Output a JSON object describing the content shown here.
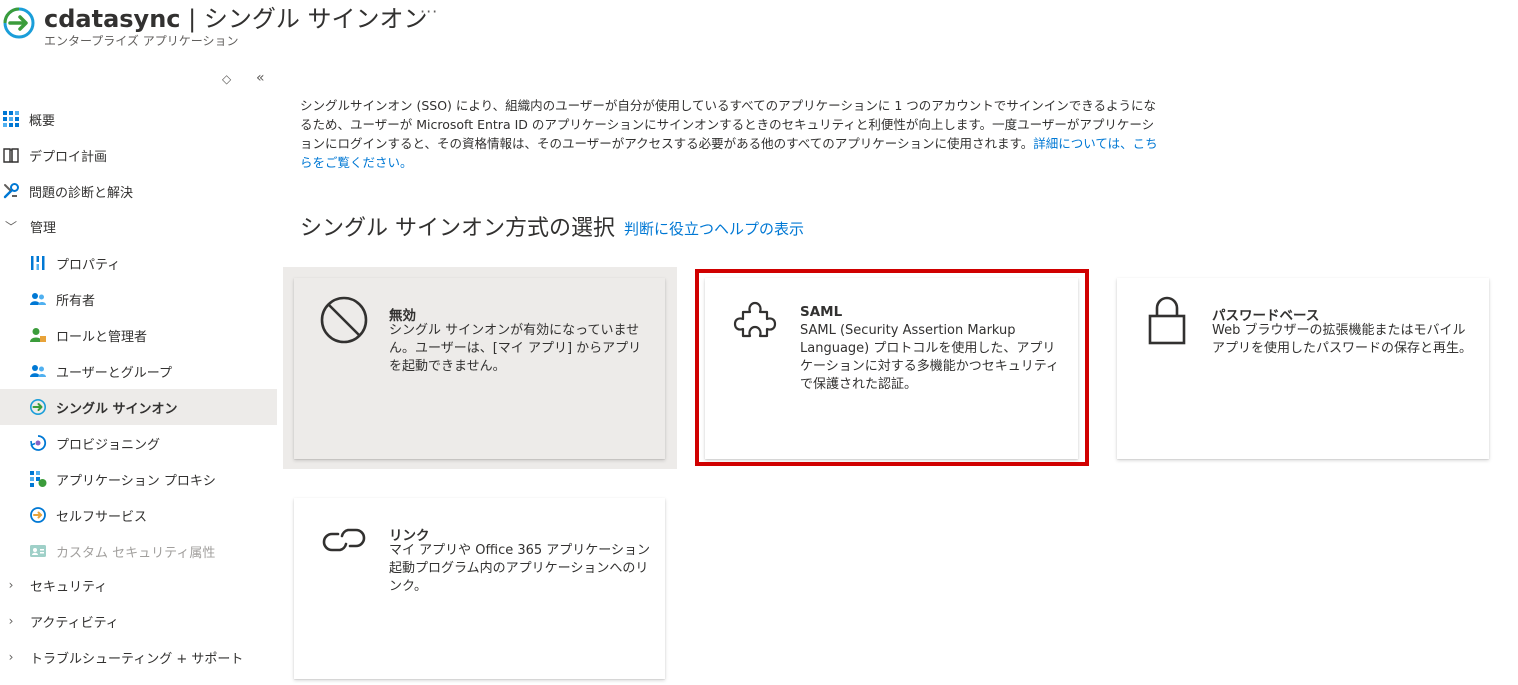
{
  "header": {
    "app_name": "cdatasync",
    "separator": "|",
    "page_name": "シングル サインオン",
    "more": "···",
    "subtitle": "エンタープライズ アプリケーション",
    "icon": "sign-in-arrow-icon"
  },
  "sidebar": {
    "tools": {
      "move": "◇",
      "collapse": "«"
    },
    "items": [
      {
        "label": "概要",
        "icon": "grid-icon"
      },
      {
        "label": "デプロイ計画",
        "icon": "book-icon"
      },
      {
        "label": "問題の診断と解決",
        "icon": "wrench-icon"
      },
      {
        "label": "管理",
        "icon": "chevron-down-icon"
      },
      {
        "label": "プロパティ",
        "icon": "properties-icon"
      },
      {
        "label": "所有者",
        "icon": "users-icon"
      },
      {
        "label": "ロールと管理者",
        "icon": "role-admin-icon"
      },
      {
        "label": "ユーザーとグループ",
        "icon": "users-groups-icon"
      },
      {
        "label": "シングル サインオン",
        "icon": "sign-in-arrow-icon"
      },
      {
        "label": "プロビジョニング",
        "icon": "provisioning-icon"
      },
      {
        "label": "アプリケーション プロキシ",
        "icon": "proxy-icon"
      },
      {
        "label": "セルフサービス",
        "icon": "self-service-icon"
      },
      {
        "label": "カスタム セキュリティ属性",
        "icon": "custom-attributes-icon"
      },
      {
        "label": "セキュリティ",
        "icon": "chevron-right-icon"
      },
      {
        "label": "アクティビティ",
        "icon": "chevron-right-icon"
      },
      {
        "label": "トラブルシューティング + サポート",
        "icon": "chevron-right-icon"
      }
    ]
  },
  "main": {
    "intro_text": "シングルサインオン (SSO) により、組織内のユーザーが自分が使用しているすべてのアプリケーションに 1 つのアカウントでサインインできるようになるため、ユーザーが Microsoft Entra ID のアプリケーションにサインオンするときのセキュリティと利便性が向上します。一度ユーザーがアプリケーションにログインすると、その資格情報は、そのユーザーがアクセスする必要がある他のすべてのアプリケーションに使用されます。",
    "intro_link": "詳細については、こちらをご覧ください。",
    "section_title": "シングル サインオン方式の選択",
    "help_link": "判断に役立つヘルプの表示",
    "cards": [
      {
        "title": "無効",
        "desc": "シングル サインオンが有効になっていません。ユーザーは、[マイ アプリ] からアプリを起動できません。",
        "icon": "disabled-circle-icon"
      },
      {
        "title": "SAML",
        "desc": "SAML (Security Assertion Markup Language) プロトコルを使用した、アプリケーションに対する多機能かつセキュリティで保護された認証。",
        "icon": "puzzle-icon"
      },
      {
        "title": "パスワードベース",
        "desc": "Web ブラウザーの拡張機能またはモバイル アプリを使用したパスワードの保存と再生。",
        "icon": "lock-icon"
      },
      {
        "title": "リンク",
        "desc": "マイ アプリや Office 365 アプリケーション起動プログラム内のアプリケーションへのリンク。",
        "icon": "link-icon"
      }
    ]
  },
  "colors": {
    "accent": "#0078d4",
    "highlight_border": "#d00000",
    "active_nav_bg": "#edebe9"
  }
}
